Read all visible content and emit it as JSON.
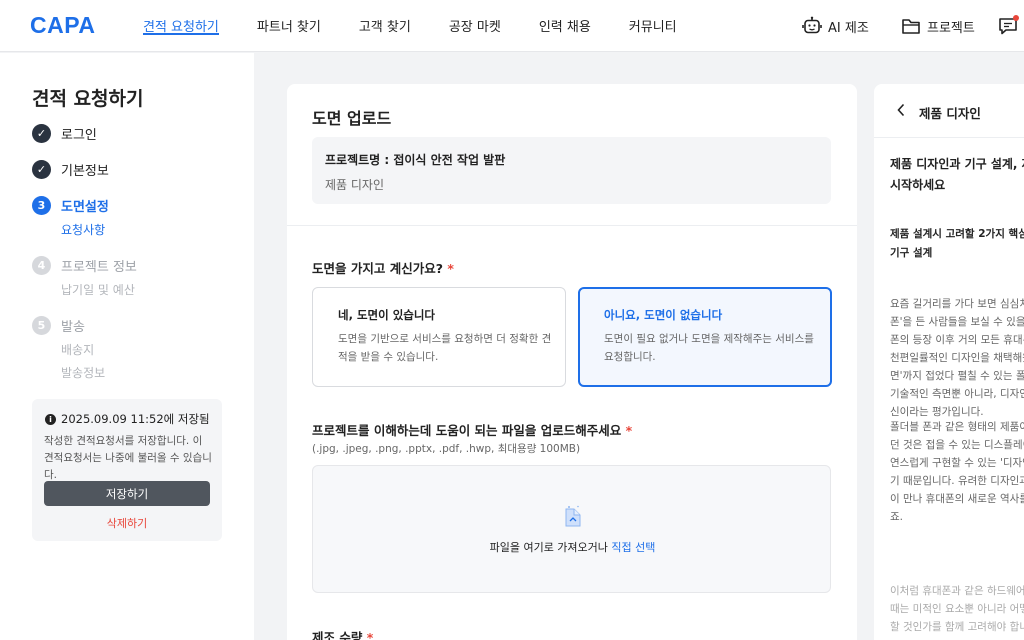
{
  "header": {
    "logo": "CAPA",
    "nav": [
      "견적 요청하기",
      "파트너 찾기",
      "고객 찾기",
      "공장 마켓",
      "인력 채용",
      "커뮤니티"
    ],
    "active_nav": "견적 요청하기",
    "ai_label": "AI 제조",
    "project_label": "프로젝트",
    "accent_color": "#1e6fe8"
  },
  "sidebar": {
    "title": "견적 요청하기",
    "steps": [
      {
        "number": "✓",
        "label": "로그인",
        "state": "done"
      },
      {
        "number": "✓",
        "label": "기본정보",
        "state": "done"
      },
      {
        "number": "3",
        "label": "도면설정",
        "state": "current",
        "sub": [
          "요청사항"
        ]
      },
      {
        "number": "4",
        "label": "프로젝트 정보",
        "state": "todo",
        "sub": [
          "납기일 및 예산"
        ]
      },
      {
        "number": "5",
        "label": "발송",
        "state": "todo",
        "sub": [
          "배송지",
          "발송정보"
        ]
      }
    ],
    "save_status": "2025.09.09 11:52에 저장됨",
    "save_desc": "작성한 견적요청서를 저장합니다. 이 견적요청서는 나중에 불러올 수 있습니다.",
    "save_button": "저장하기",
    "delete_link": "삭제하기"
  },
  "main": {
    "title": "도면 업로드",
    "project_name": "프로젝트명 : 접이식 안전 작업 발판",
    "project_category": "제품 디자인",
    "question_drawing": "도면을 가지고 계신가요?",
    "required_mark": "*",
    "options": [
      {
        "title": "네, 도면이 있습니다",
        "desc": "도면을 기반으로 서비스를 요청하면 더 정확한 견적을 받을 수 있습니다.",
        "selected": false
      },
      {
        "title": "아니요, 도면이 없습니다",
        "desc": "도면이 필요 없거나 도면을 제작해주는 서비스를 요청합니다.",
        "selected": true
      }
    ],
    "upload_label": "프로젝트를 이해하는데 도움이 되는 파일을 업로드해주세요",
    "upload_hint": "(.jpg, .jpeg, .png, .pptx, .pdf, .hwp, 최대용량 100MB)",
    "dropzone_text": "파일을 여기로 가져오거나 ",
    "dropzone_link": "직접 선택",
    "quantity_label": "제조 수량"
  },
  "right_panel": {
    "title": "제품 디자인",
    "heading": [
      "제품 디자인과 기구 설계, 제품",
      "시작하세요"
    ],
    "subheading": [
      "제품 설계시 고려할 2가지 핵심,",
      "기구 설계"
    ],
    "para1": [
      "요즘 길거리를 가다 보면 심심치",
      "폰'을 든 사람들을 보실 수 있을",
      "폰의 등장 이후 거의 모든 휴대폰",
      "천편일률적인 디자인을 채택해왔",
      "면'까지 접었다 펼칠 수 있는 폴더",
      "기술적인 측면뿐 아니라, 디자인",
      "신이라는 평가입니다."
    ],
    "para2": [
      "폴더블 폰과 같은 형태의 제품이",
      "던 것은 접을 수 있는 디스플레이",
      "연스럽게 구현할 수 있는 '디자인",
      "기 때문입니다. 유려한 디자인과",
      "이 만나 휴대폰의 새로운 역사를",
      "죠."
    ],
    "para3": [
      "이처럼 휴대폰과 같은 하드웨어",
      "때는 미적인 요소뿐 아니라 어떻",
      "할 것인가를 함께 고려해야 합니"
    ]
  }
}
